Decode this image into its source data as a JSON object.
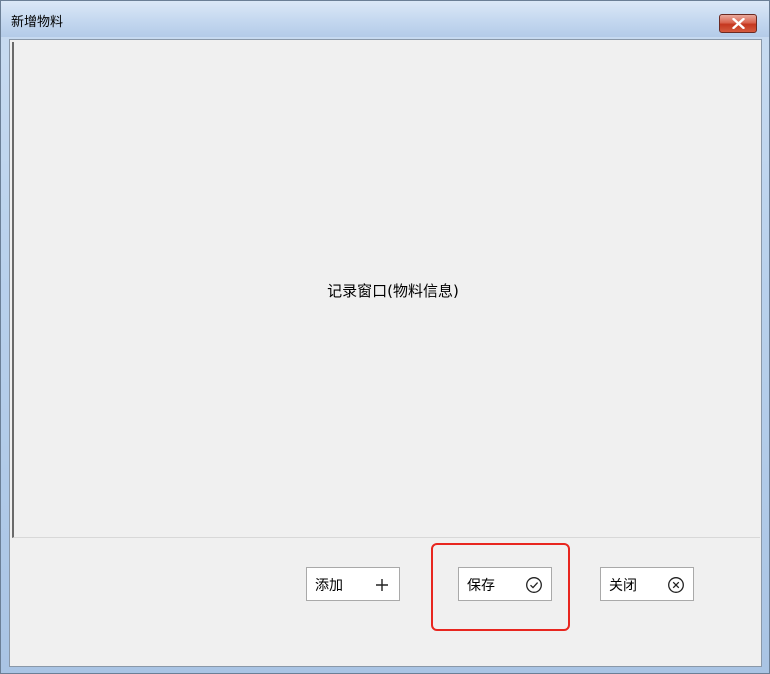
{
  "window": {
    "title": "新增物料"
  },
  "content": {
    "placeholder": "记录窗口(物料信息)"
  },
  "buttons": {
    "add": {
      "label": "添加",
      "icon": "plus-icon"
    },
    "save": {
      "label": "保存",
      "icon": "check-circle-icon"
    },
    "close": {
      "label": "关闭",
      "icon": "x-circle-icon"
    }
  },
  "colors": {
    "highlight": "#e8261f",
    "close_button": "#c5371f"
  }
}
